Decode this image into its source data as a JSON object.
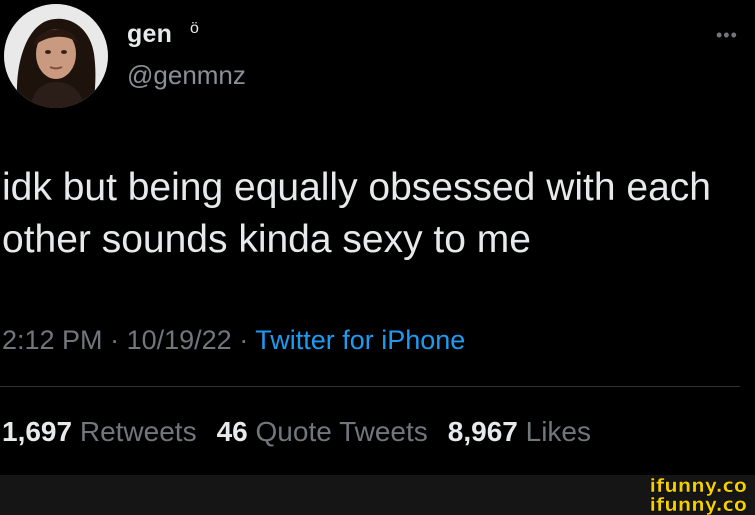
{
  "author": {
    "display_name": "gen",
    "name_emoji": "ö",
    "handle": "@genmnz"
  },
  "tweet": {
    "text": "idk but being equally obsessed with each other sounds kinda sexy to me",
    "time": "2:12 PM",
    "separator": "·",
    "date": "10/19/22",
    "source": "Twitter for iPhone"
  },
  "stats": {
    "retweets_count": "1,697",
    "retweets_label": "Retweets",
    "quotes_count": "46",
    "quotes_label": "Quote Tweets",
    "likes_count": "8,967",
    "likes_label": "Likes"
  },
  "watermark": {
    "text": "ifunny.co"
  },
  "icons": {
    "more": "more-horizontal-icon"
  },
  "colors": {
    "background": "#000000",
    "primary_text": "#e7e9ea",
    "secondary_text": "#71767b",
    "link": "#1d9bf0",
    "watermark": "#f5d000"
  }
}
